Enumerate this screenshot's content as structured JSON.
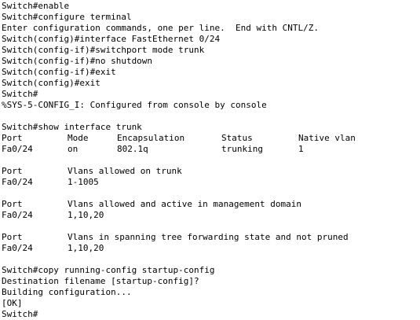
{
  "lines_top": [
    "Switch#enable",
    "Switch#configure terminal",
    "Enter configuration commands, one per line.  End with CNTL/Z.",
    "Switch(config)#interface FastEthernet 0/24",
    "Switch(config-if)#switchport mode trunk",
    "Switch(config-if)#no shutdown",
    "Switch(config-if)#exit",
    "Switch(config)#exit",
    "Switch#",
    "%SYS-5-CONFIG_I: Configured from console by console",
    "",
    "Switch#show interface trunk"
  ],
  "trunk_table": {
    "headers": [
      "Port",
      "Mode",
      "Encapsulation",
      "Status",
      "Native vlan"
    ],
    "row": [
      "Fa0/24",
      "on",
      "802.1q",
      "trunking",
      "1"
    ]
  },
  "sections": [
    {
      "header": [
        "Port",
        "Vlans allowed on trunk"
      ],
      "row": [
        "Fa0/24",
        "1-1005"
      ]
    },
    {
      "header": [
        "Port",
        "Vlans allowed and active in management domain"
      ],
      "row": [
        "Fa0/24",
        "1,10,20"
      ]
    },
    {
      "header": [
        "Port",
        "Vlans in spanning tree forwarding state and not pruned"
      ],
      "row": [
        "Fa0/24",
        "1,10,20"
      ]
    }
  ],
  "lines_bottom": [
    "Switch#copy running-config startup-config",
    "Destination filename [startup-config]?",
    "Building configuration...",
    "[OK]",
    "Switch#"
  ]
}
